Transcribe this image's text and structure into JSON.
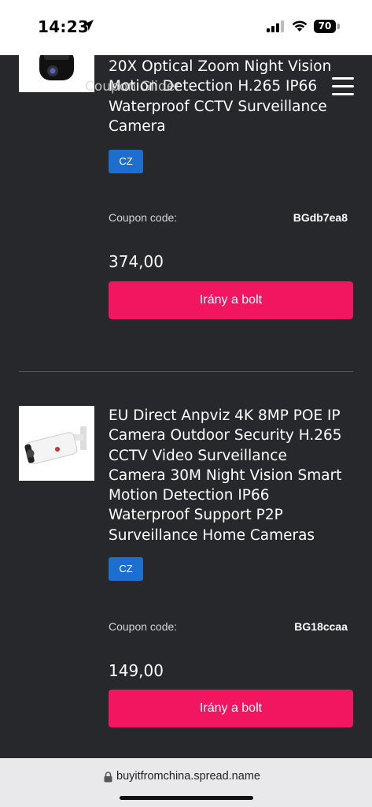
{
  "status_bar": {
    "time": "14:23",
    "battery": "70"
  },
  "header": {
    "overlay_text": "Coupon Glider"
  },
  "products": [
    {
      "title": "20X Optical Zoom Night Vision Motion Detection H.265 IP66 Waterproof CCTV Surveillance Camera",
      "badge": "CZ",
      "coupon_label": "Coupon code:",
      "coupon_code": "BGdb7ea8",
      "price": "374,00",
      "button_label": "Irány a bolt"
    },
    {
      "title": "EU Direct Anpviz 4K 8MP POE IP Camera Outdoor Security H.265 CCTV Video Surveillance Camera 30M Night Vision Smart Motion Detection IP66 Waterproof Support P2P Surveillance Home Cameras",
      "badge": "CZ",
      "coupon_label": "Coupon code:",
      "coupon_code": "BG18ccaa",
      "price": "149,00",
      "button_label": "Irány a bolt"
    }
  ],
  "browser": {
    "url": "buyitfromchina.spread.name"
  },
  "colors": {
    "background": "#27282c",
    "button": "#f2155f",
    "badge": "#1c6fcf"
  }
}
